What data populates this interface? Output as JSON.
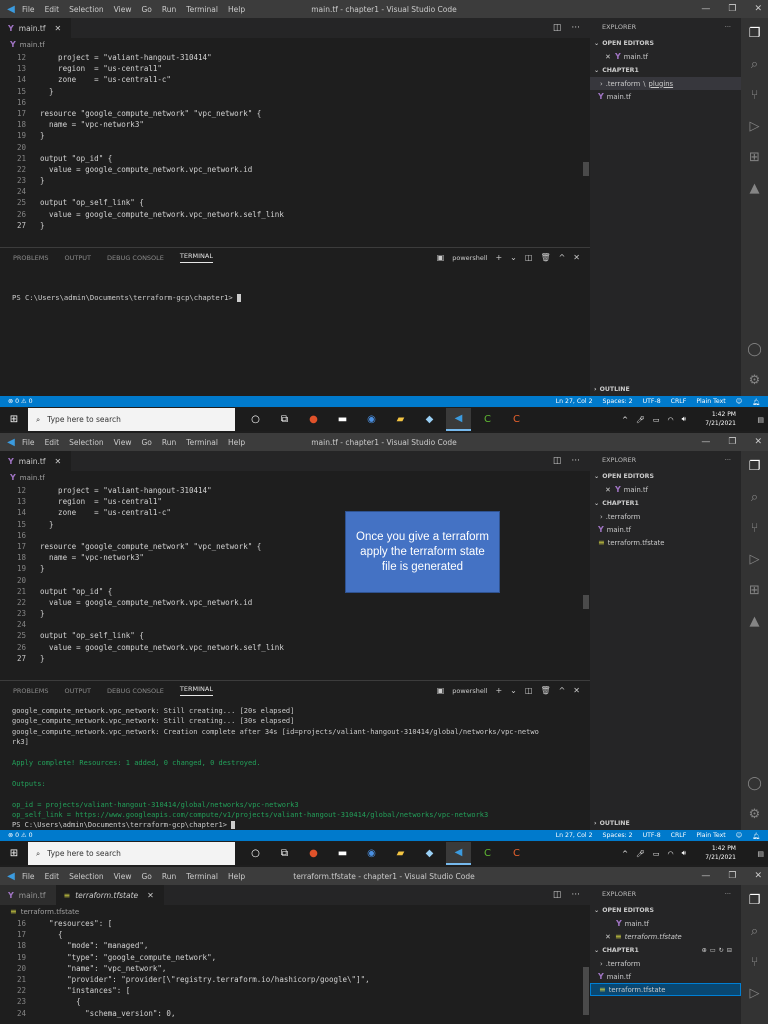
{
  "menu": [
    "File",
    "Edit",
    "Selection",
    "View",
    "Go",
    "Run",
    "Terminal",
    "Help"
  ],
  "window_titles": [
    "main.tf - chapter1 - Visual Studio Code",
    "main.tf - chapter1 - Visual Studio Code",
    "terraform.tfstate - chapter1 - Visual Studio Code"
  ],
  "tabs": {
    "main": "main.tf",
    "tfstate": "terraform.tfstate"
  },
  "breadcrumbs": {
    "main": "main.tf",
    "tfstate": "terraform.tfstate"
  },
  "code_main": [
    {
      "n": "12",
      "t": "    project = \"valiant-hangout-310414\""
    },
    {
      "n": "13",
      "t": "    region  = \"us-central1\""
    },
    {
      "n": "14",
      "t": "    zone    = \"us-central1-c\""
    },
    {
      "n": "15",
      "t": "  }"
    },
    {
      "n": "16",
      "t": ""
    },
    {
      "n": "17",
      "t": "resource \"google_compute_network\" \"vpc_network\" {"
    },
    {
      "n": "18",
      "t": "  name = \"vpc-network3\""
    },
    {
      "n": "19",
      "t": "}"
    },
    {
      "n": "20",
      "t": ""
    },
    {
      "n": "21",
      "t": "output \"op_id\" {"
    },
    {
      "n": "22",
      "t": "  value = google_compute_network.vpc_network.id"
    },
    {
      "n": "23",
      "t": "}"
    },
    {
      "n": "24",
      "t": ""
    },
    {
      "n": "25",
      "t": "output \"op_self_link\" {"
    },
    {
      "n": "26",
      "t": "  value = google_compute_network.vpc_network.self_link"
    },
    {
      "n": "27",
      "t": "}"
    }
  ],
  "code_state": [
    {
      "n": "16",
      "t": "  \"resources\": ["
    },
    {
      "n": "17",
      "t": "    {"
    },
    {
      "n": "18",
      "t": "      \"mode\": \"managed\","
    },
    {
      "n": "19",
      "t": "      \"type\": \"google_compute_network\","
    },
    {
      "n": "20",
      "t": "      \"name\": \"vpc_network\","
    },
    {
      "n": "21",
      "t": "      \"provider\": \"provider[\\\"registry.terraform.io/hashicorp/google\\\"]\","
    },
    {
      "n": "22",
      "t": "      \"instances\": ["
    },
    {
      "n": "23",
      "t": "        {"
    },
    {
      "n": "24",
      "t": "          \"schema_version\": 0,"
    }
  ],
  "terminal_tabs": [
    "PROBLEMS",
    "OUTPUT",
    "DEBUG CONSOLE",
    "TERMINAL"
  ],
  "terminal_shell": "powershell",
  "terminal1": [
    "PS C:\\Users\\admin\\Documents\\terraform-gcp\\chapter1> "
  ],
  "terminal2": [
    {
      "t": "google_compute_network.vpc_network: Still creating... [20s elapsed]",
      "c": ""
    },
    {
      "t": "google_compute_network.vpc_network: Still creating... [30s elapsed]",
      "c": ""
    },
    {
      "t": "google_compute_network.vpc_network: Creation complete after 34s [id=projects/valiant-hangout-310414/global/networks/vpc-netwo",
      "c": ""
    },
    {
      "t": "rk3]",
      "c": ""
    },
    {
      "t": "",
      "c": ""
    },
    {
      "t": "Apply complete! Resources: 1 added, 0 changed, 0 destroyed.",
      "c": "green"
    },
    {
      "t": "",
      "c": ""
    },
    {
      "t": "Outputs:",
      "c": "green"
    },
    {
      "t": "",
      "c": ""
    },
    {
      "t": "op_id = projects/valiant-hangout-310414/global/networks/vpc-network3",
      "c": "green"
    },
    {
      "t": "op_self_link = https://www.googleapis.com/compute/v1/projects/valiant-hangout-310414/global/networks/vpc-network3",
      "c": "green"
    },
    {
      "t": "PS C:\\Users\\admin\\Documents\\terraform-gcp\\chapter1> ",
      "c": ""
    }
  ],
  "explorer": {
    "title": "EXPLORER",
    "open_editors": "OPEN EDITORS",
    "folder": "CHAPTER1",
    "outline": "OUTLINE",
    "terraform_dir": ".terraform",
    "plugins": "plugins",
    "main": "main.tf",
    "tfstate": "terraform.tfstate"
  },
  "status": {
    "errors": "⊗ 0 ⚠ 0",
    "position": "Ln 27, Col 2",
    "spaces": "Spaces: 2",
    "encoding": "UTF-8",
    "eol": "CRLF",
    "language": "Plain Text"
  },
  "taskbar": {
    "search": "Type here to search",
    "time": "1:42 PM",
    "date": "7/21/2021"
  },
  "callout": "Once you give a terraform apply the terraform state file is generated",
  "colors": {
    "status_bar": "#007acc",
    "callout": "#4472c4",
    "terminal_success": "#23a05a"
  }
}
